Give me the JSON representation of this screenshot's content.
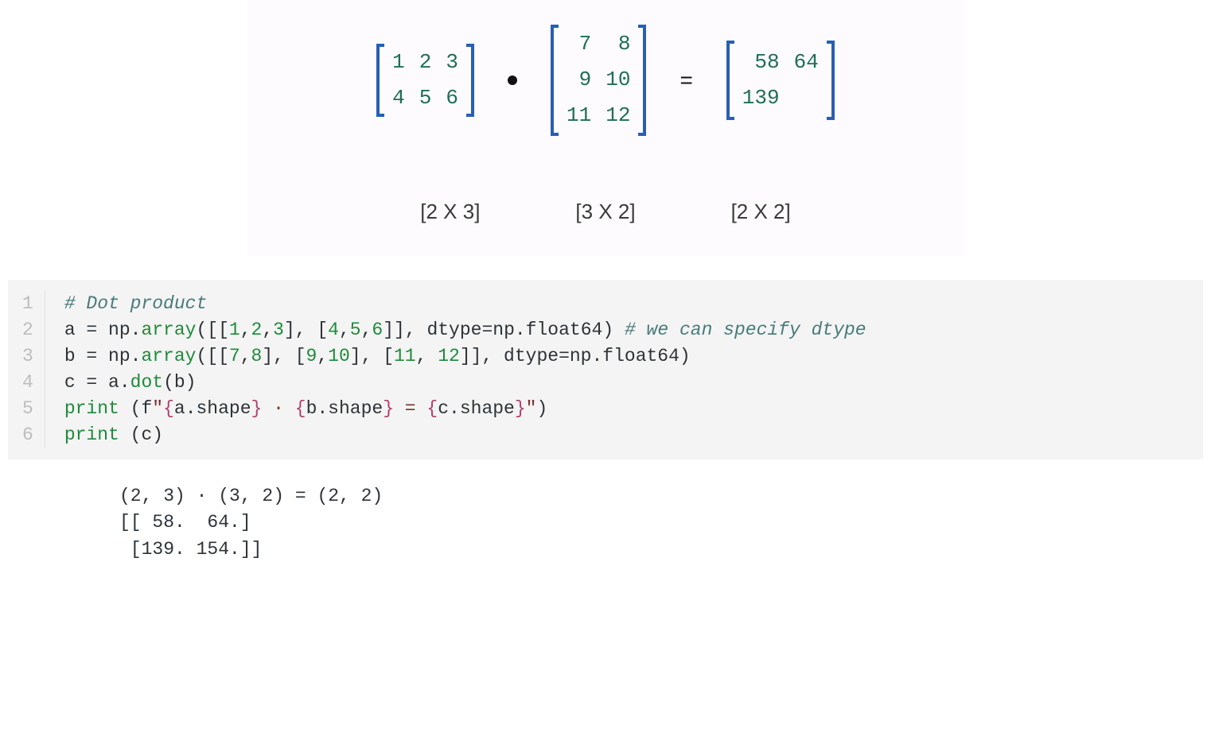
{
  "diagram": {
    "matrixA": [
      [
        "1",
        "2",
        "3"
      ],
      [
        "4",
        "5",
        "6"
      ]
    ],
    "matrixB": [
      [
        "7",
        "8"
      ],
      [
        "9",
        "10"
      ],
      [
        "11",
        "12"
      ]
    ],
    "matrixC": [
      [
        "58",
        "64"
      ],
      [
        "139",
        ""
      ]
    ],
    "equals": "=",
    "shapeA": "[2 X 3]",
    "shapeB": "[3 X 2]",
    "shapeC": "[2 X 2]"
  },
  "code": {
    "line_numbers": [
      "1",
      "2",
      "3",
      "4",
      "5",
      "6"
    ],
    "l1": {
      "comment": "# Dot product"
    },
    "l2": {
      "a": "a ",
      "eq": "= ",
      "np": "np",
      "dot1": ".",
      "array": "array",
      "open": "([[",
      "n1": "1",
      "c1": ",",
      "n2": "2",
      "c2": ",",
      "n3": "3",
      "mid": "], [",
      "n4": "4",
      "c3": ",",
      "n5": "5",
      "c4": ",",
      "n6": "6",
      "close": "]], ",
      "dtype": "dtype",
      "eq2": "=",
      "np2": "np",
      "dot2": ".",
      "f64": "float64",
      "paren": ")",
      "sp": " ",
      "comment": "# we can specify dtype"
    },
    "l3": {
      "b": "b ",
      "eq": "= ",
      "np": "np",
      "dot1": ".",
      "array": "array",
      "open": "([[",
      "n1": "7",
      "c1": ",",
      "n2": "8",
      "mid1": "], [",
      "n3": "9",
      "c2": ",",
      "n4": "10",
      "mid2": "], [",
      "n5": "11",
      "c3": ", ",
      "n6": "12",
      "close": "]], ",
      "dtype": "dtype",
      "eq2": "=",
      "np2": "np",
      "dot2": ".",
      "f64": "float64",
      "paren": ")"
    },
    "l4": {
      "c": "c ",
      "eq": "= ",
      "a": "a",
      "dot": ".",
      "dotfn": "dot",
      "open": "(",
      "b": "b",
      "close": ")"
    },
    "l5": {
      "print": "print ",
      "open": "(",
      "f": "f",
      "q1": "\"",
      "ob1": "{",
      "ashape": "a.shape",
      "cb1": "}",
      "mid": " · ",
      "ob2": "{",
      "bshape": "b.shape",
      "cb2": "}",
      "eq": " = ",
      "ob3": "{",
      "cshape": "c.shape",
      "cb3": "}",
      "q2": "\"",
      "close": ")"
    },
    "l6": {
      "print": "print ",
      "open": "(",
      "c": "c",
      "close": ")"
    }
  },
  "output": {
    "line1": "(2, 3) · (3, 2) = (2, 2)",
    "line2": "[[ 58.  64.]",
    "line3": " [139. 154.]]"
  }
}
